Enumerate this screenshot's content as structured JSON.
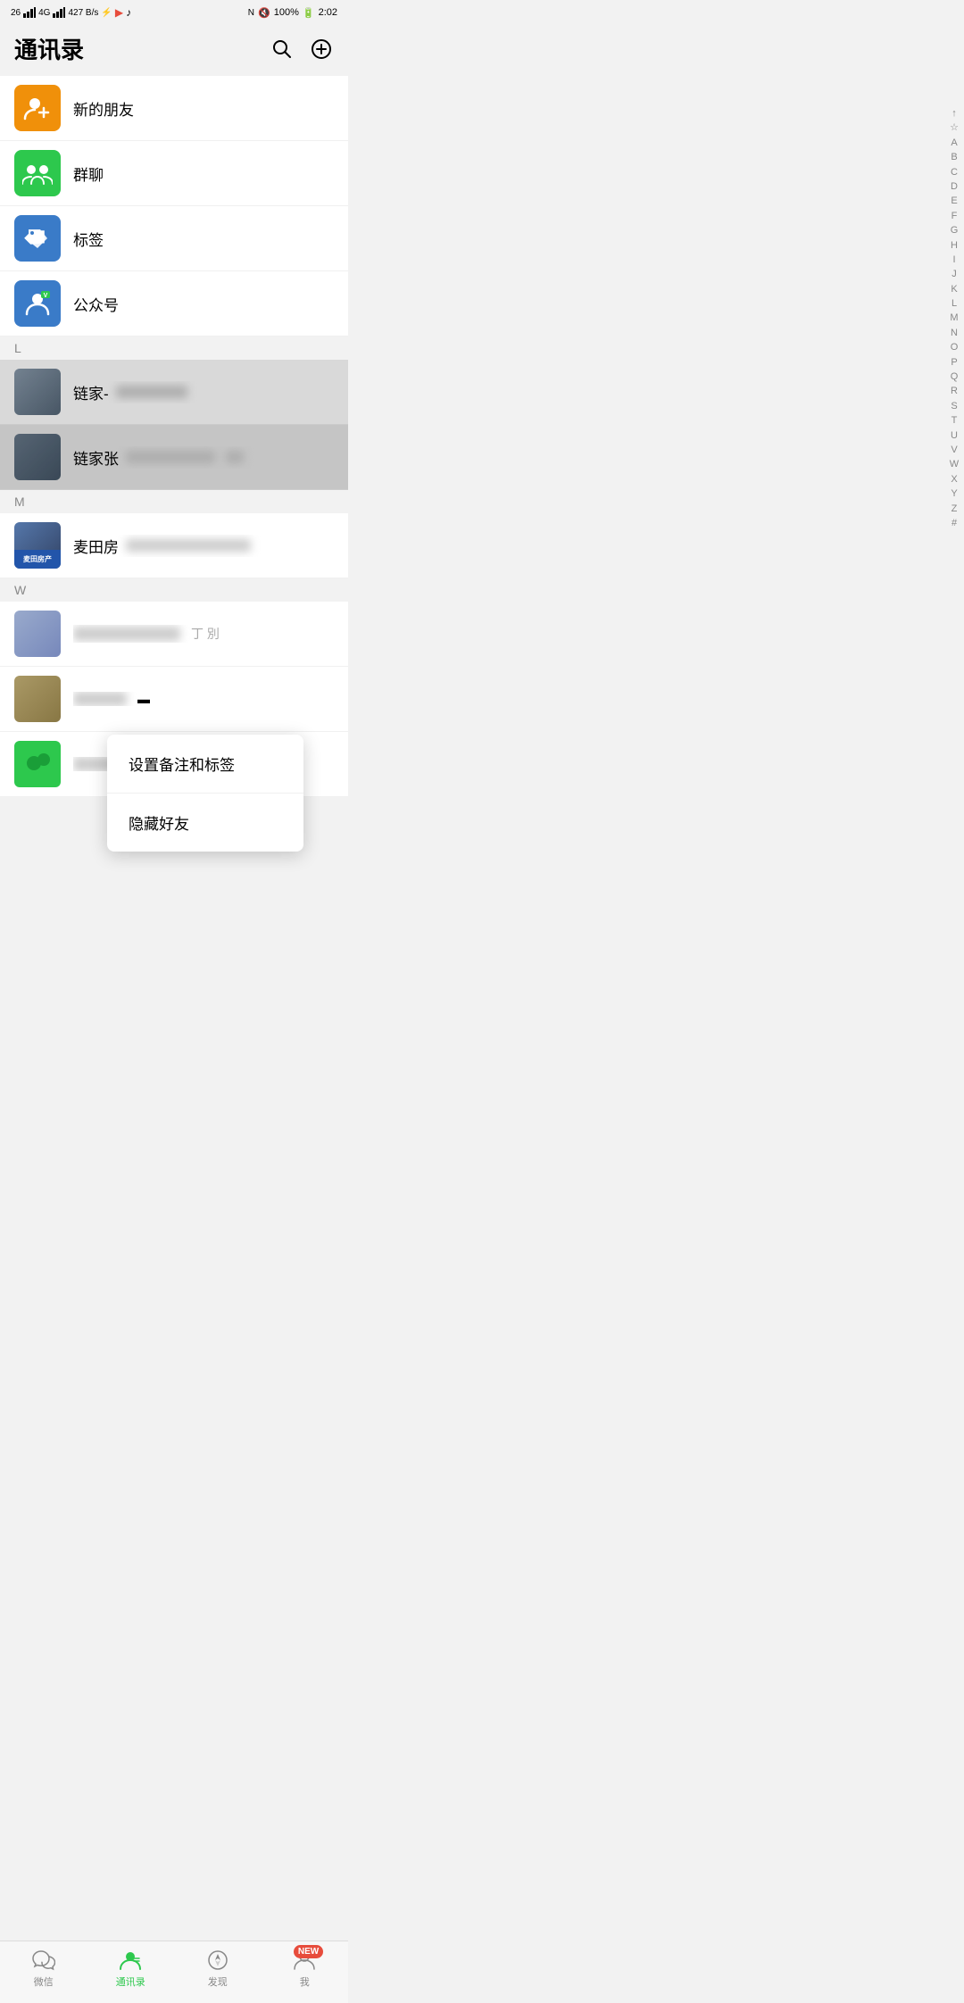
{
  "statusBar": {
    "left": "26  4G  4G  427 B/s",
    "network": "NFC",
    "battery": "100%",
    "time": "2:02"
  },
  "header": {
    "title": "通讯录",
    "searchLabel": "搜索",
    "addLabel": "添加"
  },
  "specialItems": [
    {
      "id": "new-friends",
      "icon": "person-add",
      "iconColor": "orange",
      "label": "新的朋友"
    },
    {
      "id": "group-chat",
      "icon": "group",
      "iconColor": "green",
      "label": "群聊"
    },
    {
      "id": "tags",
      "icon": "tag",
      "iconColor": "blue-dark",
      "label": "标签"
    },
    {
      "id": "official",
      "icon": "person-badge",
      "iconColor": "blue",
      "label": "公众号"
    }
  ],
  "contextMenu": {
    "items": [
      {
        "id": "set-remark",
        "label": "设置备注和标签"
      },
      {
        "id": "hide-friend",
        "label": "隐藏好友"
      }
    ]
  },
  "sections": [
    {
      "letter": "L",
      "contacts": [
        {
          "id": "lianjia1",
          "name": "链家-",
          "nameBlurred": true,
          "extra": "10166"
        },
        {
          "id": "lianjia2",
          "name": "链家张",
          "nameBlurred": true,
          "highlighted": true
        }
      ]
    },
    {
      "letter": "M",
      "contacts": [
        {
          "id": "maitian",
          "name": "麦田房产",
          "nameBlurred": true
        }
      ]
    },
    {
      "letter": "W",
      "contacts": [
        {
          "id": "wcontact1",
          "name": "blurred",
          "nameBlurred": true
        },
        {
          "id": "wcontact2",
          "name": "blurred2",
          "nameBlurred": true
        },
        {
          "id": "wcontact3",
          "name": "",
          "nameBlurred": true,
          "isGreen": true
        }
      ]
    }
  ],
  "alphaIndex": [
    "↑",
    "☆",
    "A",
    "B",
    "C",
    "D",
    "E",
    "F",
    "G",
    "H",
    "I",
    "J",
    "K",
    "L",
    "M",
    "N",
    "O",
    "P",
    "Q",
    "R",
    "S",
    "T",
    "U",
    "V",
    "W",
    "X",
    "Y",
    "Z",
    "#"
  ],
  "bottomNav": [
    {
      "id": "wechat",
      "label": "微信",
      "active": false
    },
    {
      "id": "contacts",
      "label": "通讯录",
      "active": true
    },
    {
      "id": "discover",
      "label": "发现",
      "active": false
    },
    {
      "id": "me",
      "label": "我",
      "active": false,
      "badge": "NEW"
    }
  ]
}
